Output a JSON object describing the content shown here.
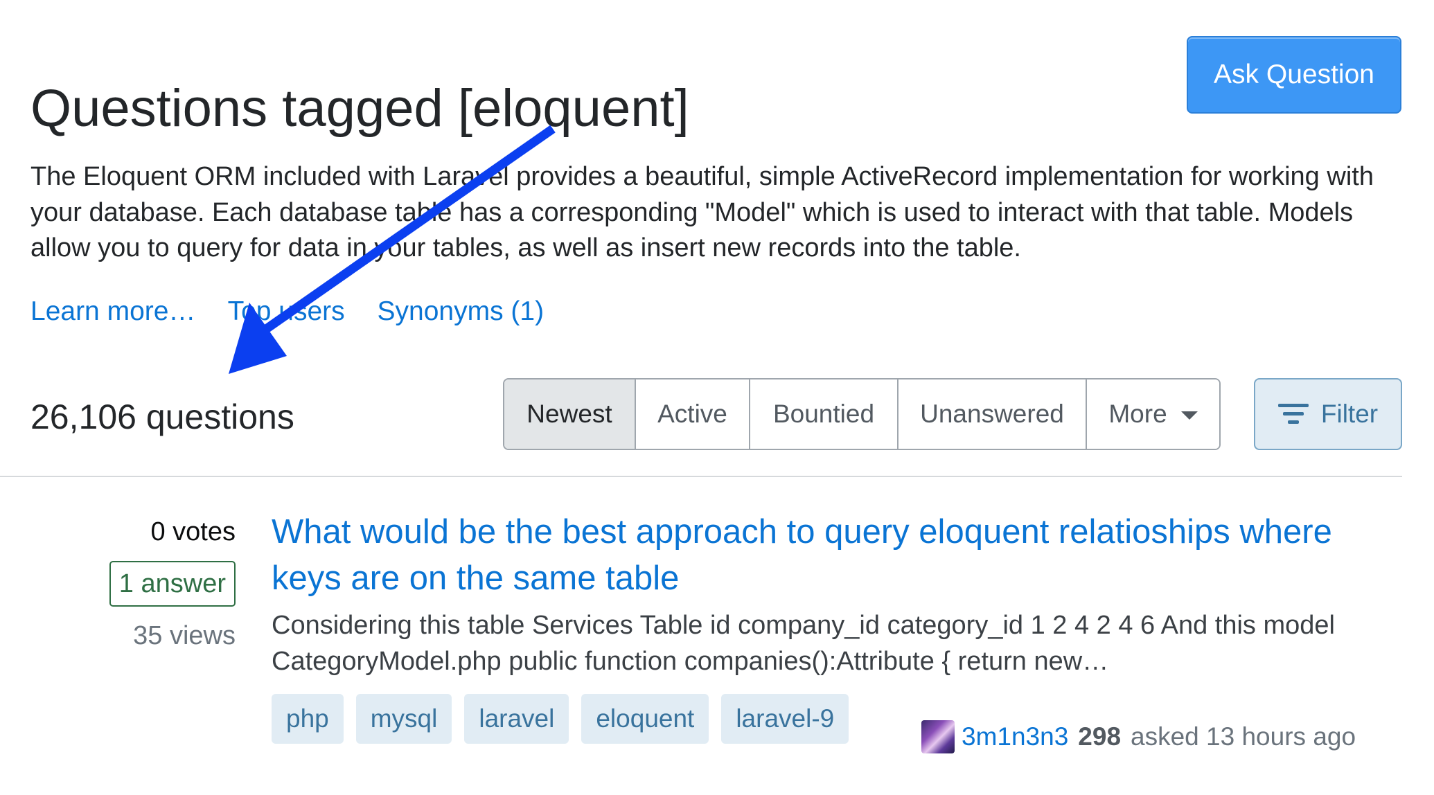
{
  "header": {
    "title": "Questions tagged [eloquent]",
    "ask_button": "Ask Question"
  },
  "tag_info": {
    "description": "The Eloquent ORM included with Laravel provides a beautiful, simple ActiveRecord implementation for working with your database. Each database table has a corresponding \"Model\" which is used to interact with that table. Models allow you to query for data in your tables, as well as insert new records into the table.",
    "links": {
      "learn_more": "Learn more…",
      "top_users": "Top users",
      "synonyms": "Synonyms (1)"
    }
  },
  "question_count": "26,106 questions",
  "sort_tabs": {
    "newest": "Newest",
    "active": "Active",
    "bountied": "Bountied",
    "unanswered": "Unanswered",
    "more": "More",
    "selected": "Newest"
  },
  "filter_button": "Filter",
  "question": {
    "votes": "0 votes",
    "answers": "1 answer",
    "views": "35 views",
    "title": "What would be the best approach to query eloquent relatioships where keys are on the same table",
    "excerpt": "Considering this table Services Table id company_id category_id 1 2 4 2 4 6 And this model CategoryModel.php public function companies():Attribute { return new…",
    "tags": [
      "php",
      "mysql",
      "laravel",
      "eloquent",
      "laravel-9"
    ],
    "user": {
      "name": "3m1n3n3",
      "reputation": "298",
      "asked": "asked 13 hours ago"
    }
  },
  "colors": {
    "link": "#0a74d4",
    "primary_button": "#3d97f5",
    "tag_bg": "#e1ecf4",
    "tag_text": "#39739d",
    "answered_green": "#2f6f44",
    "annotation_arrow": "#0b3ff0"
  },
  "icons": {
    "filter": "filter-lines-icon",
    "more": "caret-down-icon"
  }
}
